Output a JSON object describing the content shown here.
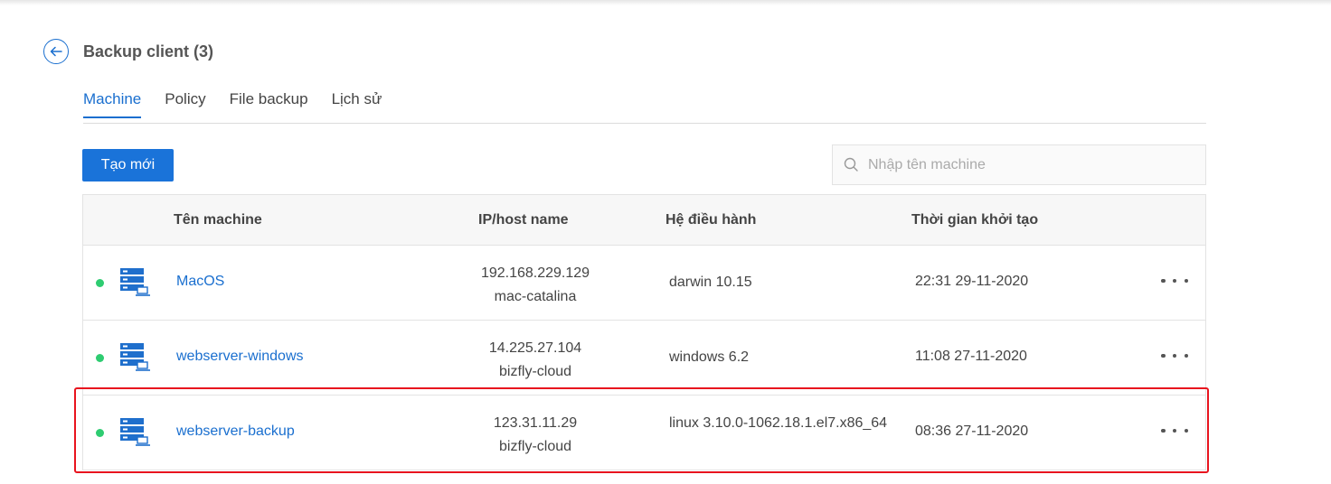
{
  "header": {
    "title": "Backup client (3)"
  },
  "tabs": [
    {
      "label": "Machine",
      "active": true
    },
    {
      "label": "Policy",
      "active": false
    },
    {
      "label": "File backup",
      "active": false
    },
    {
      "label": "Lịch sử",
      "active": false
    }
  ],
  "toolbar": {
    "create_label": "Tạo mới",
    "search_placeholder": "Nhập tên machine"
  },
  "table": {
    "columns": [
      "Tên machine",
      "IP/host name",
      "Hệ điều hành",
      "Thời gian khởi tạo"
    ],
    "rows": [
      {
        "status": "online",
        "name": "MacOS",
        "ip": "192.168.229.129",
        "host": "mac-catalina",
        "os": "darwin 10.15",
        "created": "22:31 29-11-2020"
      },
      {
        "status": "online",
        "name": "webserver-windows",
        "ip": "14.225.27.104",
        "host": "bizfly-cloud",
        "os": "windows 6.2",
        "created": "11:08 27-11-2020"
      },
      {
        "status": "online",
        "name": "webserver-backup",
        "ip": "123.31.11.29",
        "host": "bizfly-cloud",
        "os": "linux 3.10.0-1062.18.1.el7.x86_64",
        "created": "08:36 27-11-2020"
      }
    ]
  },
  "colors": {
    "accent": "#1a6fcf",
    "status_online": "#2ecc71",
    "highlight": "#e8141e"
  },
  "icons": {
    "back": "arrow-left-circle-icon",
    "search": "search-icon",
    "machine": "server-computer-icon",
    "more": "more-horizontal-icon"
  }
}
